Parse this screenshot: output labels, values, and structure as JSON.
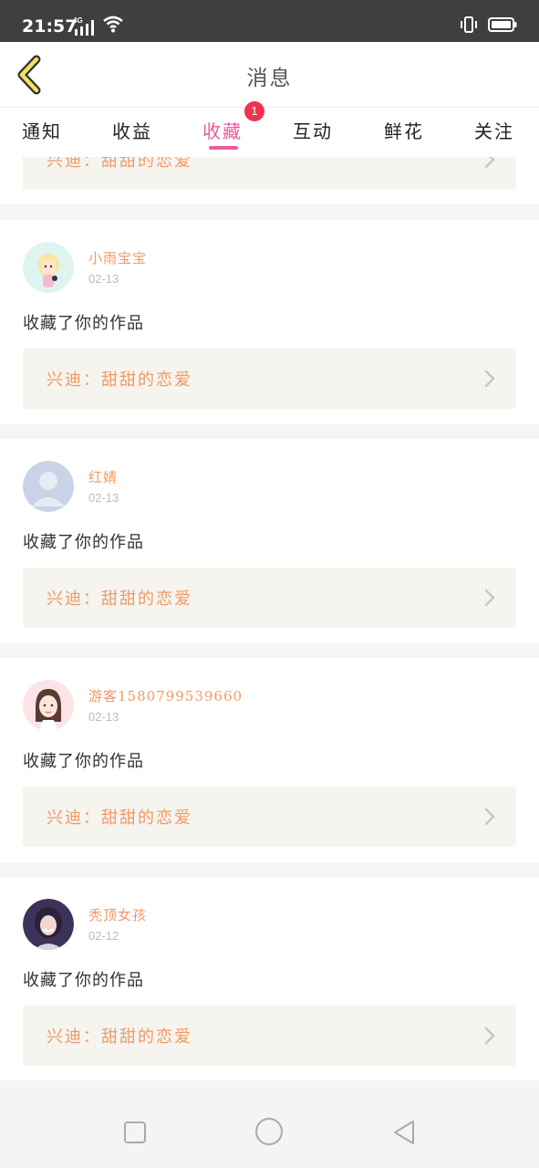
{
  "status_bar": {
    "time": "21:57",
    "network": "4G"
  },
  "header": {
    "title": "消息"
  },
  "tabs": [
    {
      "label": "通知"
    },
    {
      "label": "收益"
    },
    {
      "label": "收藏"
    },
    {
      "label": "互动"
    },
    {
      "label": "鲜花"
    },
    {
      "label": "关注"
    }
  ],
  "active_tab": "收藏",
  "badge_count": "1",
  "top_partial_item": {
    "work_title": "兴迪：甜甜的恋爱"
  },
  "items": [
    {
      "username": "小雨宝宝",
      "date": "02-13",
      "action": "收藏了你的作品",
      "work_title": "兴迪：甜甜的恋爱",
      "avatar": "cartoon-avatar"
    },
    {
      "username": "红婧",
      "date": "02-13",
      "action": "收藏了你的作品",
      "work_title": "兴迪：甜甜的恋爱",
      "avatar": "default-avatar"
    },
    {
      "username": "游客1580799539660",
      "date": "02-13",
      "action": "收藏了你的作品",
      "work_title": "兴迪：甜甜的恋爱",
      "avatar": "girl-illustration-avatar"
    },
    {
      "username": "秃顶女孩",
      "date": "02-12",
      "action": "收藏了你的作品",
      "work_title": "兴迪：甜甜的恋爱",
      "avatar": "photo-avatar"
    }
  ],
  "colors": {
    "accent": "#ea5b9d",
    "orange_text": "#f09a68",
    "badge": "#f0324e",
    "box_bg": "#f5f4ee"
  }
}
